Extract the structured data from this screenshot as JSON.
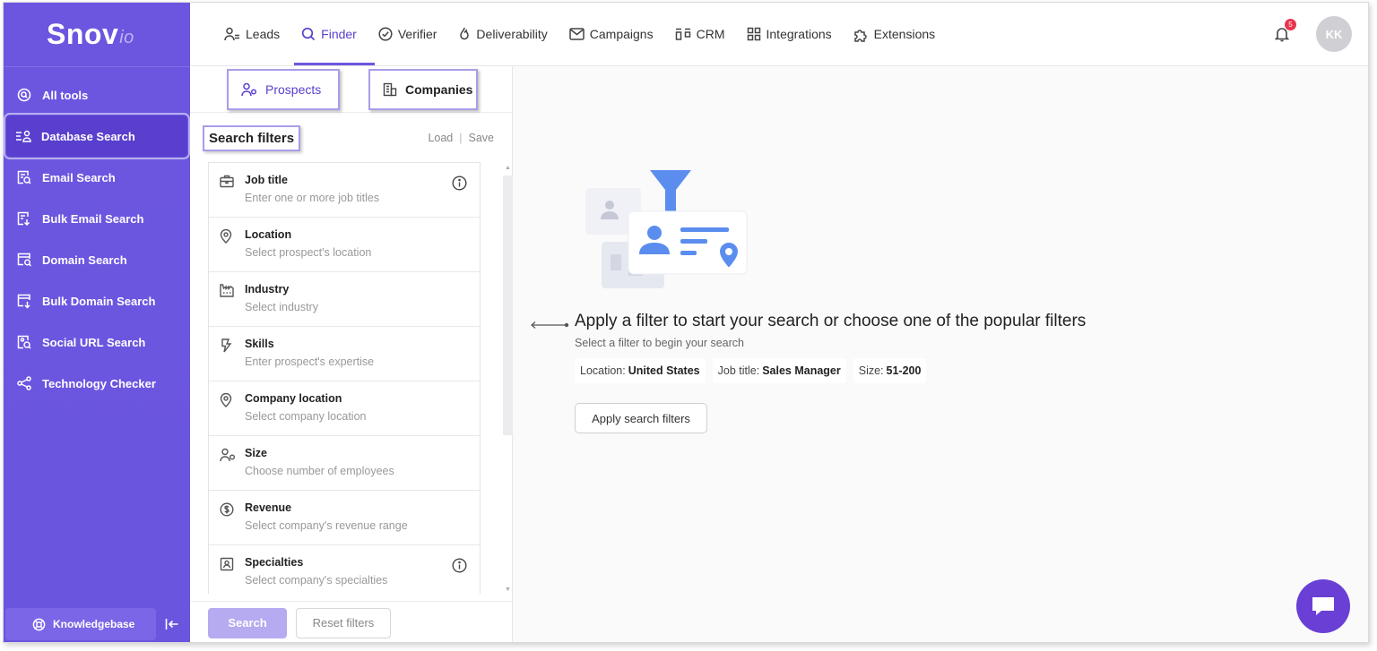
{
  "app": {
    "logo_main": "Snov",
    "logo_suffix": "io"
  },
  "sidebar": {
    "items": [
      {
        "label": "All tools",
        "icon": "search-circle-icon"
      },
      {
        "label": "Database Search",
        "icon": "database-search-icon",
        "active": true
      },
      {
        "label": "Email Search",
        "icon": "email-search-icon"
      },
      {
        "label": "Bulk Email Search",
        "icon": "bulk-email-search-icon"
      },
      {
        "label": "Domain Search",
        "icon": "domain-search-icon"
      },
      {
        "label": "Bulk Domain Search",
        "icon": "bulk-domain-search-icon"
      },
      {
        "label": "Social URL Search",
        "icon": "social-url-search-icon"
      },
      {
        "label": "Technology Checker",
        "icon": "technology-icon"
      }
    ],
    "knowledgebase_label": "Knowledgebase"
  },
  "topbar": {
    "menu": [
      {
        "label": "Leads",
        "icon": "leads-icon"
      },
      {
        "label": "Finder",
        "icon": "search-icon",
        "active": true
      },
      {
        "label": "Verifier",
        "icon": "check-circle-icon"
      },
      {
        "label": "Deliverability",
        "icon": "flame-icon"
      },
      {
        "label": "Campaigns",
        "icon": "mail-icon"
      },
      {
        "label": "CRM",
        "icon": "crm-icon"
      },
      {
        "label": "Integrations",
        "icon": "grid-icon"
      },
      {
        "label": "Extensions",
        "icon": "puzzle-icon"
      }
    ],
    "notification_count": "5",
    "avatar_initials": "KK"
  },
  "filter_panel": {
    "tabs": [
      {
        "label": "Prospects",
        "active": true
      },
      {
        "label": "Companies"
      }
    ],
    "title": "Search filters",
    "load_label": "Load",
    "save_label": "Save",
    "filters": [
      {
        "name": "Job title",
        "hint": "Enter one or more job titles",
        "icon": "briefcase-icon",
        "info": true
      },
      {
        "name": "Location",
        "hint": "Select prospect's location",
        "icon": "location-pin-icon"
      },
      {
        "name": "Industry",
        "hint": "Select industry",
        "icon": "factory-icon"
      },
      {
        "name": "Skills",
        "hint": "Enter prospect's expertise",
        "icon": "lightning-icon"
      },
      {
        "name": "Company location",
        "hint": "Select company location",
        "icon": "location-pin-icon"
      },
      {
        "name": "Size",
        "hint": "Choose number of employees",
        "icon": "people-icon"
      },
      {
        "name": "Revenue",
        "hint": "Select company's revenue range",
        "icon": "dollar-circle-icon"
      },
      {
        "name": "Specialties",
        "hint": "Select company's specialties",
        "icon": "id-card-icon",
        "info": true
      }
    ],
    "search_button": "Search",
    "reset_button": "Reset filters"
  },
  "main": {
    "title": "Apply a filter to start your search or choose one of the popular filters",
    "subtitle": "Select a filter to begin your search",
    "chips": [
      {
        "key": "Location:",
        "value": "United States"
      },
      {
        "key": "Job title:",
        "value": "Sales Manager"
      },
      {
        "key": "Size:",
        "value": "51-200"
      }
    ],
    "apply_button": "Apply search filters"
  },
  "colors": {
    "brand": "#6c56e0",
    "brand_dark": "#5a3fce",
    "illustration_blue": "#5b8def",
    "chat_button": "#6a3fd6"
  }
}
